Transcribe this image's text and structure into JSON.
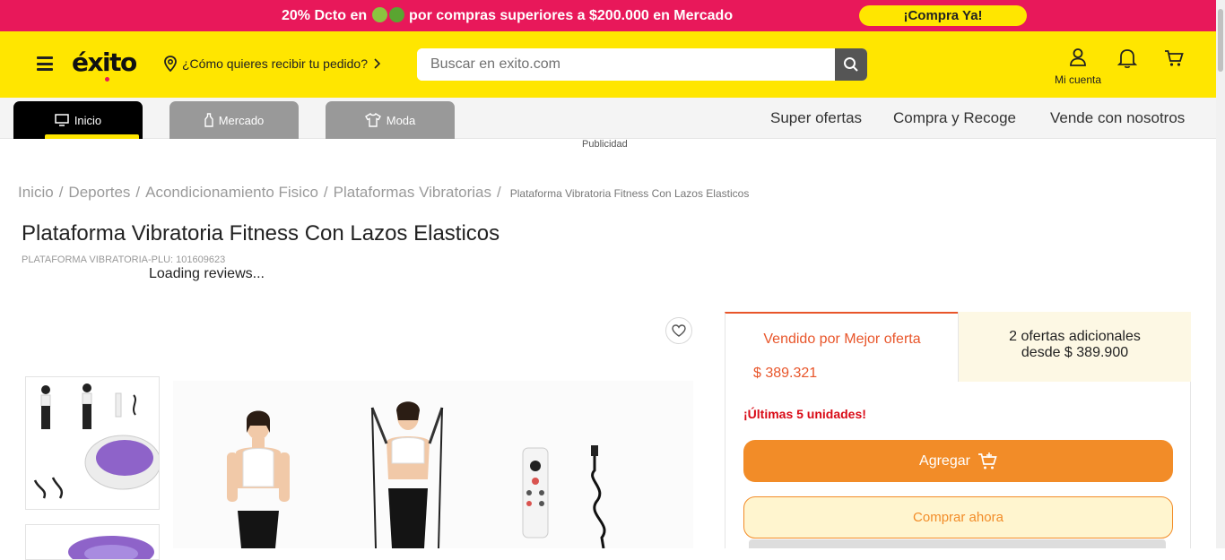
{
  "promo": {
    "text_before": "20% Dcto en",
    "text_after": "por compras superiores a $200.000 en Mercado",
    "cta": "¡Compra Ya!"
  },
  "header": {
    "logo": "éxito",
    "delivery_prompt": "¿Cómo quieres recibir tu pedido?",
    "search_placeholder": "Buscar en exito.com",
    "account_label": "Mi cuenta"
  },
  "category_tabs": [
    {
      "label": "Inicio",
      "icon": "monitor-icon",
      "active": true
    },
    {
      "label": "Mercado",
      "icon": "bottle-icon",
      "active": false
    },
    {
      "label": "Moda",
      "icon": "shirt-icon",
      "active": false
    }
  ],
  "nav_links": [
    "Super ofertas",
    "Compra y Recoge",
    "Vende con nosotros"
  ],
  "ad_label": "Publicidad",
  "breadcrumb": {
    "items": [
      "Inicio",
      "Deportes",
      "Acondicionamiento Fisico",
      "Plataformas Vibratorias"
    ],
    "separator": "/",
    "current": "Plataforma Vibratoria Fitness Con Lazos Elasticos"
  },
  "product": {
    "title": "Plataforma Vibratoria Fitness Con Lazos Elasticos",
    "plu": "PLATAFORMA VIBRATORIA-PLU: 101609623",
    "reviews_status": "Loading reviews..."
  },
  "seller": {
    "active_label": "Vendido por Mejor oferta",
    "active_price": "$ 389.321",
    "other_line1": "2 ofertas adicionales",
    "other_line2": "desde $ 389.900"
  },
  "purchase": {
    "stock_warning": "¡Últimas 5 unidades!",
    "add_label": "Agregar",
    "buy_now_label": "Comprar ahora"
  },
  "colors": {
    "promo_bg": "#e8185a",
    "brand_yellow": "#ffe600",
    "accent_orange": "#f28c28",
    "stock_red": "#d90a16"
  }
}
